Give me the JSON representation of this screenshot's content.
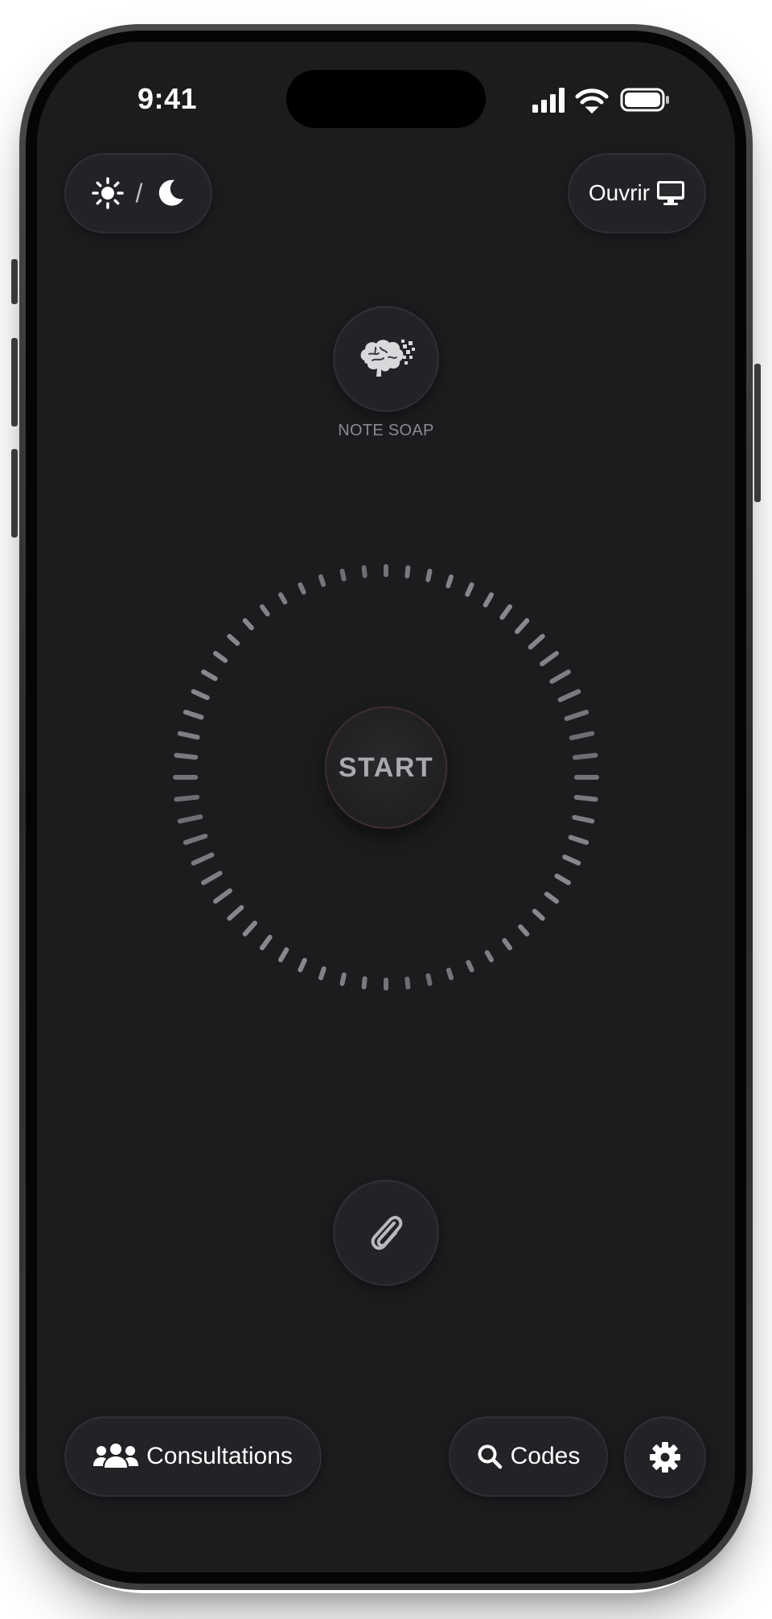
{
  "status_bar": {
    "time": "9:41",
    "icons": [
      "cellular-signal-icon",
      "wifi-icon",
      "battery-icon"
    ]
  },
  "top_bar": {
    "theme_toggle": {
      "separator": "/",
      "icons": [
        "sun-icon",
        "moon-icon"
      ]
    },
    "open_button": {
      "label": "Ouvrir",
      "icon": "desktop-monitor-icon"
    }
  },
  "soap": {
    "icon": "brain-icon",
    "label": "NOTE SOAP"
  },
  "recorder": {
    "start_label": "START"
  },
  "attachment": {
    "icon": "paperclip-icon"
  },
  "bottom_bar": {
    "consultations": {
      "label": "Consultations",
      "icon": "users-group-icon"
    },
    "codes": {
      "label": "Codes",
      "icon": "search-icon"
    },
    "settings": {
      "icon": "gear-icon"
    }
  },
  "colors": {
    "screen_bg": "#1b1c1e",
    "button_bg": "#222326",
    "text_primary": "#ffffff",
    "text_muted": "#8a8b8f"
  }
}
